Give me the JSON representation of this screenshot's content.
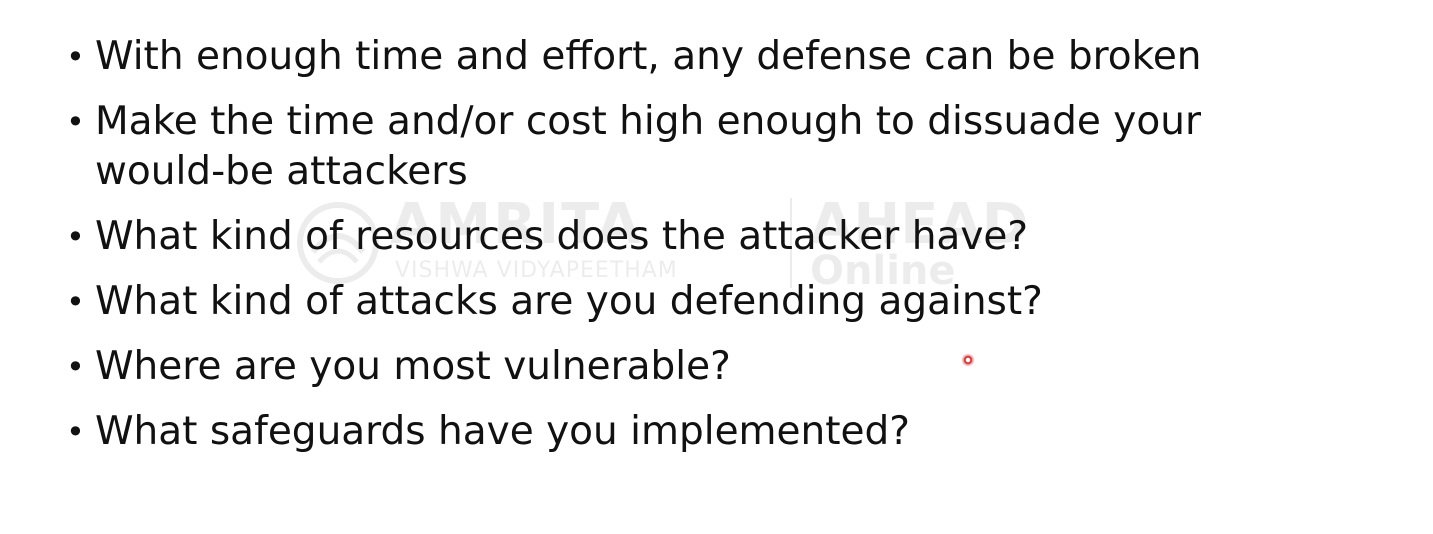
{
  "watermark": {
    "main_text": "AMRITA",
    "sub_text": "VISHWA VIDYAPEETHAM",
    "ahead_text": "AHEAD",
    "online_text": "Online"
  },
  "bullets": [
    "With enough time and effort, any defense can be broken",
    "Make the time and/or cost high enough to dissuade your would-be attackers",
    "What kind of resources does the attacker have?",
    "What kind of attacks are you defending against?",
    "Where are you most vulnerable?",
    "What safeguards have you implemented?"
  ],
  "bullet_marker": "•",
  "colors": {
    "text": "#111111",
    "background": "#ffffff",
    "pointer": "#d93a3a"
  }
}
